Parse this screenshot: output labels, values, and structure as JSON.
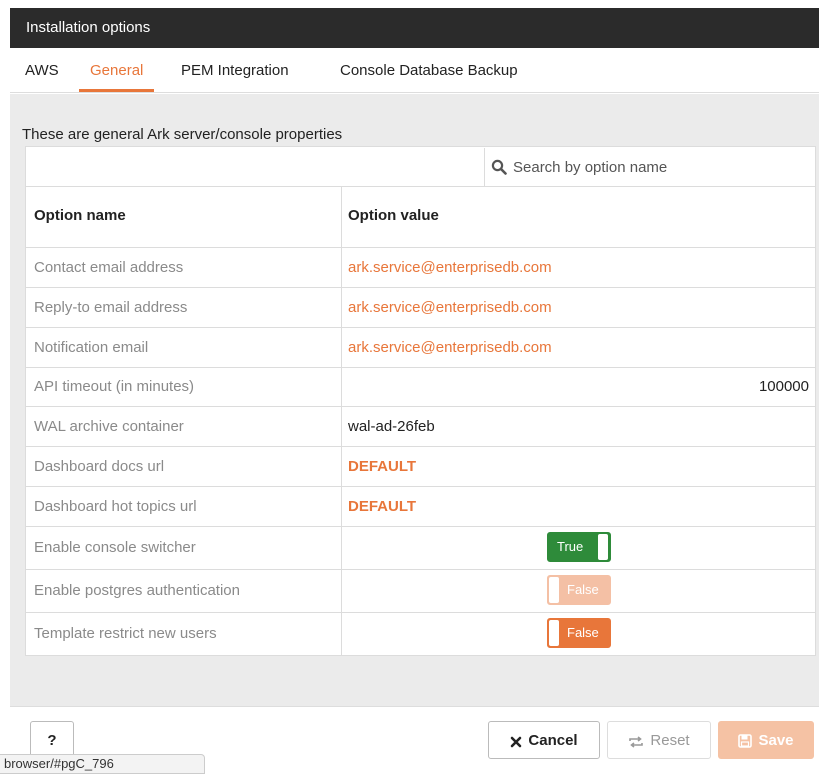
{
  "dialog": {
    "title": "Installation options"
  },
  "tabs": [
    {
      "label": "AWS",
      "active": false
    },
    {
      "label": "General",
      "active": true
    },
    {
      "label": "PEM Integration",
      "active": false
    },
    {
      "label": "Console Database Backup",
      "active": false
    }
  ],
  "general": {
    "description": "These are general Ark server/console properties",
    "search": {
      "placeholder": "Search by option name",
      "icon": "search-icon"
    },
    "columns": {
      "name": "Option name",
      "value": "Option value"
    },
    "rows": [
      {
        "name": "Contact email address",
        "value": "ark.service@enterprisedb.com"
      },
      {
        "name": "Reply-to email address",
        "value": "ark.service@enterprisedb.com"
      },
      {
        "name": "Notification email",
        "value": "ark.service@enterprisedb.com"
      },
      {
        "name": "API timeout (in minutes)",
        "value": "100000"
      },
      {
        "name": "WAL archive container",
        "value": "wal-ad-26feb"
      },
      {
        "name": "Dashboard docs url",
        "value": "DEFAULT"
      },
      {
        "name": "Dashboard hot topics url",
        "value": "DEFAULT"
      },
      {
        "name": "Enable console switcher",
        "value": "True"
      },
      {
        "name": "Enable postgres authentication",
        "value": "False"
      },
      {
        "name": "Template restrict new users",
        "value": "False"
      }
    ]
  },
  "footer": {
    "help_label": "?",
    "cancel_label": "Cancel",
    "reset_label": "Reset",
    "save_label": "Save"
  },
  "statusbar": {
    "text": "browser/#pgC_796"
  },
  "colors": {
    "accent": "#e8763a",
    "titlebar": "#2b2b2b",
    "toggle_on": "#2e8b3a",
    "save_disabled": "#f5c2a4"
  }
}
